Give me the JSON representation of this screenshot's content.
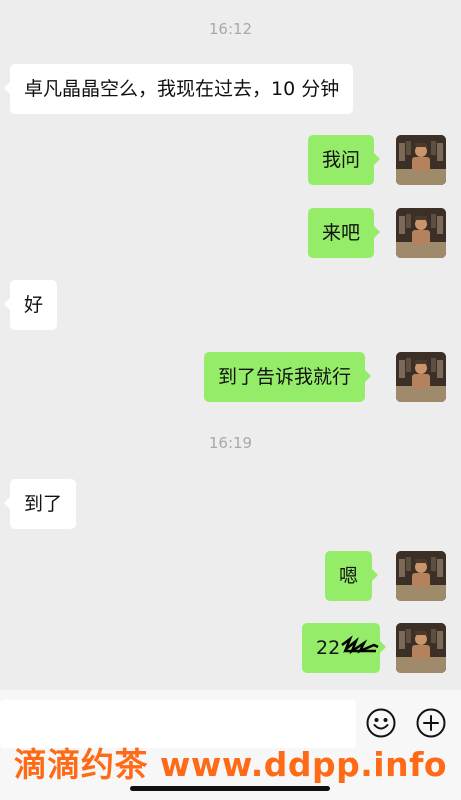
{
  "messages": [
    {
      "type": "time",
      "text": "16:12"
    },
    {
      "type": "left",
      "text": "卓凡晶晶空么，我现在过去，10 分钟"
    },
    {
      "type": "right",
      "text": "我问"
    },
    {
      "type": "right",
      "text": "来吧"
    },
    {
      "type": "left",
      "text": "好"
    },
    {
      "type": "right",
      "text": "到了告诉我就行"
    },
    {
      "type": "time",
      "text": "16:19"
    },
    {
      "type": "left",
      "text": "到了"
    },
    {
      "type": "right",
      "text": "嗯"
    },
    {
      "type": "right",
      "text": "22"
    }
  ],
  "input": {
    "placeholder": ""
  },
  "icons": {
    "emoji": "emoji-icon",
    "plus": "plus-icon"
  },
  "watermark": "滴滴约茶 www.ddpp.info",
  "colors": {
    "sent_bubble": "#95ec69",
    "received_bubble": "#ffffff",
    "background": "#ededed",
    "watermark": "#ff6a16"
  }
}
